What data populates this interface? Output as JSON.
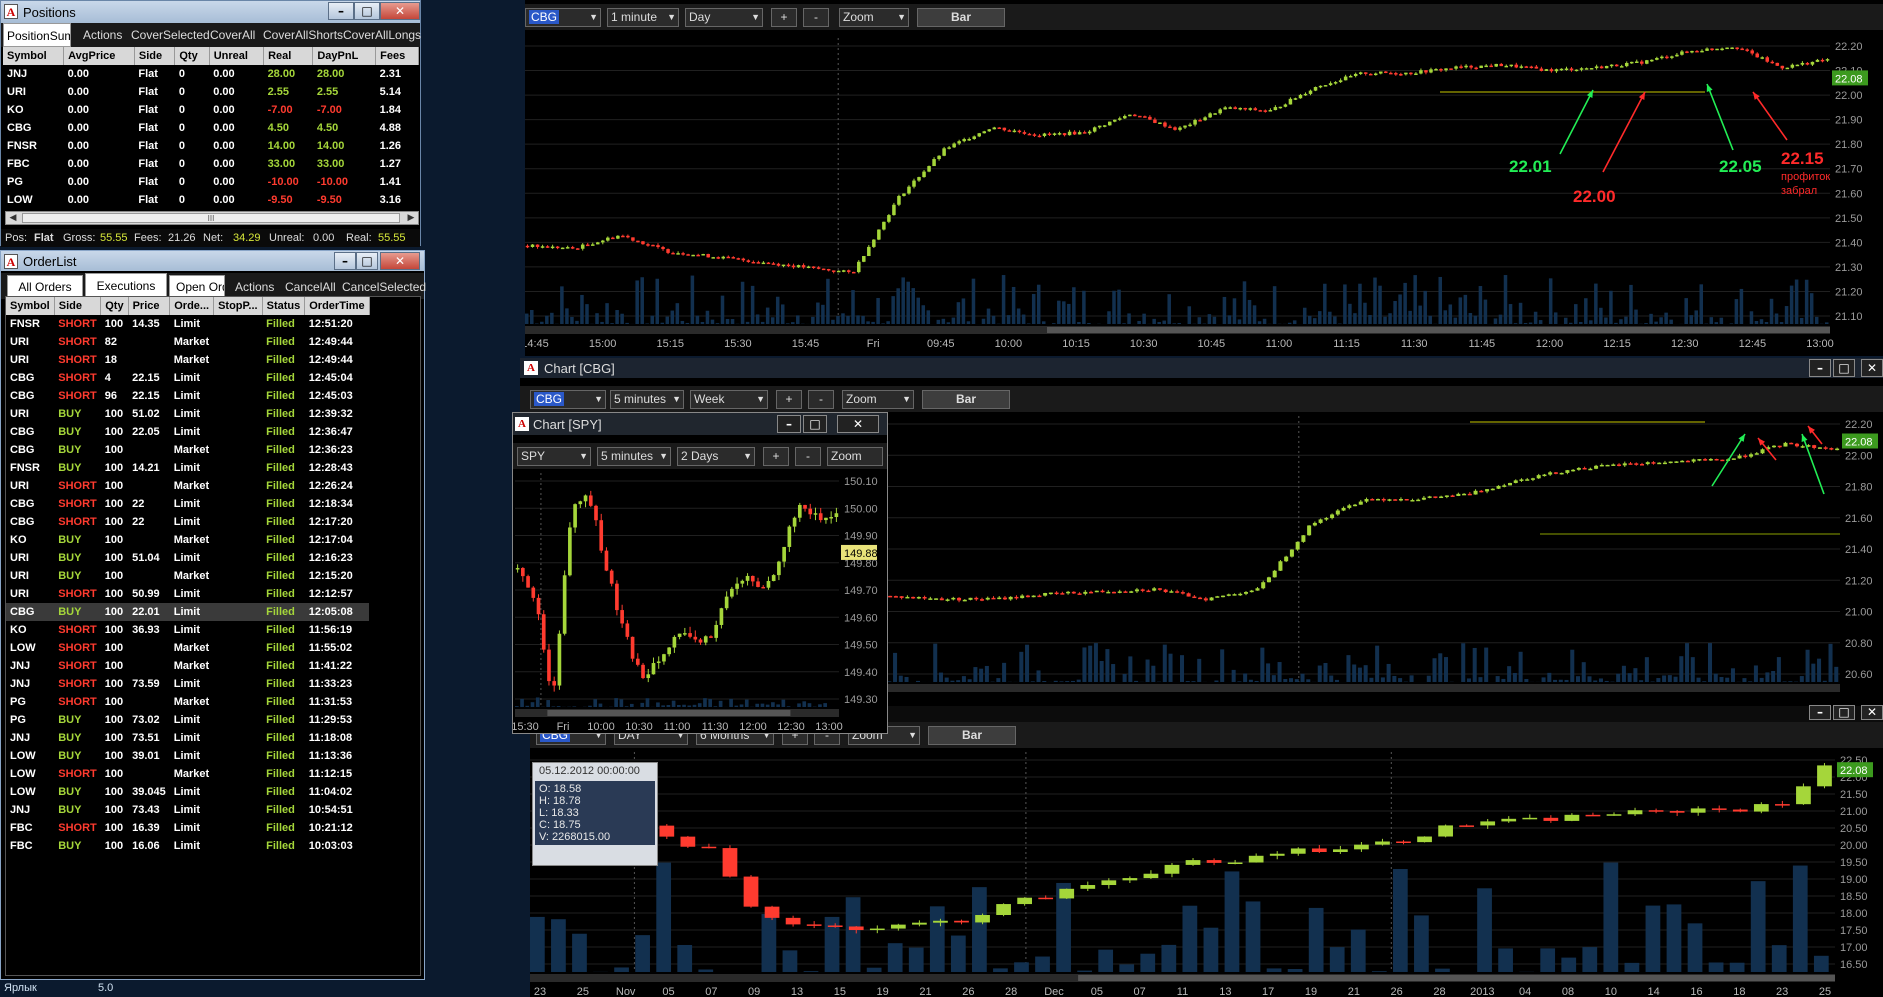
{
  "positions": {
    "title": "Positions",
    "tabs": [
      "PositionSummary",
      "Actions",
      "CoverSelected",
      "CoverAll",
      "CoverAllShorts",
      "CoverAllLongs"
    ],
    "columns": [
      "Symbol",
      "AvgPrice",
      "Side",
      "Qty",
      "Unreal",
      "Real",
      "DayPnL",
      "Fees"
    ],
    "rows": [
      [
        "JNJ",
        "0.00",
        "Flat",
        "0",
        "0.00",
        "28.00",
        "28.00",
        "2.31"
      ],
      [
        "URI",
        "0.00",
        "Flat",
        "0",
        "0.00",
        "2.55",
        "2.55",
        "5.14"
      ],
      [
        "KO",
        "0.00",
        "Flat",
        "0",
        "0.00",
        "-7.00",
        "-7.00",
        "1.84"
      ],
      [
        "CBG",
        "0.00",
        "Flat",
        "0",
        "0.00",
        "4.50",
        "4.50",
        "4.88"
      ],
      [
        "FNSR",
        "0.00",
        "Flat",
        "0",
        "0.00",
        "14.00",
        "14.00",
        "1.26"
      ],
      [
        "FBC",
        "0.00",
        "Flat",
        "0",
        "0.00",
        "33.00",
        "33.00",
        "1.27"
      ],
      [
        "PG",
        "0.00",
        "Flat",
        "0",
        "0.00",
        "-10.00",
        "-10.00",
        "1.41"
      ],
      [
        "LOW",
        "0.00",
        "Flat",
        "0",
        "0.00",
        "-9.50",
        "-9.50",
        "3.16"
      ]
    ],
    "status": {
      "pos_label": "Pos:",
      "pos": "Flat",
      "gross_label": "Gross:",
      "gross": "55.55",
      "fees_label": "Fees:",
      "fees": "21.26",
      "net_label": "Net:",
      "net": "34.29",
      "unreal_label": "Unreal:",
      "unreal": "0.00",
      "real_label": "Real:",
      "real": "55.55"
    },
    "scroll_grip": "III"
  },
  "orderlist": {
    "title": "OrderList",
    "tabs": [
      "All Orders",
      "Executions",
      "Open Orders",
      "Actions",
      "CancelAll",
      "CancelSelected"
    ],
    "columns": [
      "Symbol",
      "Side",
      "Qty",
      "Price",
      "Orde...",
      "StopP...",
      "Status",
      "OrderTime"
    ],
    "rows": [
      [
        "FNSR",
        "SHORT",
        "100",
        "14.35",
        "Limit",
        "",
        "Filled",
        "12:51:20"
      ],
      [
        "URI",
        "SHORT",
        "82",
        "",
        "Market",
        "",
        "Filled",
        "12:49:44"
      ],
      [
        "URI",
        "SHORT",
        "18",
        "",
        "Market",
        "",
        "Filled",
        "12:49:44"
      ],
      [
        "CBG",
        "SHORT",
        "4",
        "22.15",
        "Limit",
        "",
        "Filled",
        "12:45:04"
      ],
      [
        "CBG",
        "SHORT",
        "96",
        "22.15",
        "Limit",
        "",
        "Filled",
        "12:45:03"
      ],
      [
        "URI",
        "BUY",
        "100",
        "51.02",
        "Limit",
        "",
        "Filled",
        "12:39:32"
      ],
      [
        "CBG",
        "BUY",
        "100",
        "22.05",
        "Limit",
        "",
        "Filled",
        "12:36:47"
      ],
      [
        "CBG",
        "BUY",
        "100",
        "",
        "Market",
        "",
        "Filled",
        "12:36:23"
      ],
      [
        "FNSR",
        "BUY",
        "100",
        "14.21",
        "Limit",
        "",
        "Filled",
        "12:28:43"
      ],
      [
        "URI",
        "SHORT",
        "100",
        "",
        "Market",
        "",
        "Filled",
        "12:26:24"
      ],
      [
        "CBG",
        "SHORT",
        "100",
        "22",
        "Limit",
        "",
        "Filled",
        "12:18:34"
      ],
      [
        "CBG",
        "SHORT",
        "100",
        "22",
        "Limit",
        "",
        "Filled",
        "12:17:20"
      ],
      [
        "KO",
        "BUY",
        "100",
        "",
        "Market",
        "",
        "Filled",
        "12:17:04"
      ],
      [
        "URI",
        "BUY",
        "100",
        "51.04",
        "Limit",
        "",
        "Filled",
        "12:16:23"
      ],
      [
        "URI",
        "BUY",
        "100",
        "",
        "Market",
        "",
        "Filled",
        "12:15:20"
      ],
      [
        "URI",
        "SHORT",
        "100",
        "50.99",
        "Limit",
        "",
        "Filled",
        "12:12:57"
      ],
      [
        "CBG",
        "BUY",
        "100",
        "22.01",
        "Limit",
        "",
        "Filled",
        "12:05:08"
      ],
      [
        "KO",
        "SHORT",
        "100",
        "36.93",
        "Limit",
        "",
        "Filled",
        "11:56:19"
      ],
      [
        "LOW",
        "SHORT",
        "100",
        "",
        "Market",
        "",
        "Filled",
        "11:55:02"
      ],
      [
        "JNJ",
        "SHORT",
        "100",
        "",
        "Market",
        "",
        "Filled",
        "11:41:22"
      ],
      [
        "JNJ",
        "SHORT",
        "100",
        "73.59",
        "Limit",
        "",
        "Filled",
        "11:33:23"
      ],
      [
        "PG",
        "SHORT",
        "100",
        "",
        "Market",
        "",
        "Filled",
        "11:31:53"
      ],
      [
        "PG",
        "BUY",
        "100",
        "73.02",
        "Limit",
        "",
        "Filled",
        "11:29:53"
      ],
      [
        "JNJ",
        "BUY",
        "100",
        "73.51",
        "Limit",
        "",
        "Filled",
        "11:18:08"
      ],
      [
        "LOW",
        "BUY",
        "100",
        "39.01",
        "Limit",
        "",
        "Filled",
        "11:13:36"
      ],
      [
        "LOW",
        "SHORT",
        "100",
        "",
        "Market",
        "",
        "Filled",
        "11:12:15"
      ],
      [
        "LOW",
        "BUY",
        "100",
        "39.045",
        "Limit",
        "",
        "Filled",
        "11:04:02"
      ],
      [
        "JNJ",
        "BUY",
        "100",
        "73.43",
        "Limit",
        "",
        "Filled",
        "10:54:51"
      ],
      [
        "FBC",
        "SHORT",
        "100",
        "16.39",
        "Limit",
        "",
        "Filled",
        "10:21:12"
      ],
      [
        "FBC",
        "BUY",
        "100",
        "16.06",
        "Limit",
        "",
        "Filled",
        "10:03:03"
      ]
    ],
    "selected_row": 16
  },
  "chart1": {
    "symbol": "CBG",
    "interval": "1 minute",
    "period": "Day",
    "zoom": "Zoom",
    "type": "Bar",
    "plus": "+",
    "minus": "-",
    "price_labels": [
      "22.20",
      "22.10",
      "22.00",
      "21.90",
      "21.80",
      "21.70",
      "21.60",
      "21.50",
      "21.40",
      "21.30",
      "21.20",
      "21.10"
    ],
    "last": "22.08",
    "time_labels": [
      "14:45",
      "15:00",
      "15:15",
      "15:30",
      "15:45",
      "Fri",
      "09:45",
      "10:00",
      "10:15",
      "10:30",
      "10:45",
      "11:00",
      "11:15",
      "11:30",
      "11:45",
      "12:00",
      "12:15",
      "12:30",
      "12:45",
      "13:00"
    ],
    "annotations": [
      {
        "text": "22.01",
        "color": "#22ee55"
      },
      {
        "text": "22.00",
        "color": "#ff2a2a"
      },
      {
        "text": "22.05",
        "color": "#22ee55"
      },
      {
        "text": "22.15",
        "color": "#ff2a2a"
      },
      {
        "text": "профиток",
        "color": "#ff2a2a"
      },
      {
        "text": "забрал",
        "color": "#ff2a2a"
      }
    ]
  },
  "chart2": {
    "title": "Chart [CBG]",
    "symbol": "CBG",
    "interval": "5 minutes",
    "period": "Week",
    "zoom": "Zoom",
    "type": "Bar",
    "plus": "+",
    "minus": "-",
    "price_labels": [
      "22.20",
      "22.00",
      "21.80",
      "21.60",
      "21.40",
      "21.20",
      "21.00",
      "20.80",
      "20.60"
    ],
    "last": "22.08"
  },
  "chart_spy": {
    "title": "Chart [SPY]",
    "symbol": "SPY",
    "interval": "5 minutes",
    "period": "2 Days",
    "zoom": "Zoom",
    "plus": "+",
    "minus": "-",
    "price_labels": [
      "150.10",
      "150.00",
      "149.90",
      "149.80",
      "149.70",
      "149.60",
      "149.50",
      "149.40",
      "149.30"
    ],
    "last": "149.88",
    "time_labels": [
      "15:30",
      "Fri",
      "10:00",
      "10:30",
      "11:00",
      "11:30",
      "12:00",
      "12:30",
      "13:00"
    ]
  },
  "chart3": {
    "symbol": "CBG",
    "interval": "DAY",
    "period": "6 Months",
    "zoom": "Zoom",
    "type": "Bar",
    "plus": "+",
    "minus": "-",
    "price_labels": [
      "22.50",
      "22.00",
      "21.50",
      "21.00",
      "20.50",
      "20.00",
      "19.50",
      "19.00",
      "18.50",
      "18.00",
      "17.50",
      "17.00",
      "16.50"
    ],
    "last": "22.08",
    "time_labels": [
      "23",
      "25",
      "Nov",
      "05",
      "07",
      "09",
      "13",
      "15",
      "19",
      "21",
      "26",
      "28",
      "Dec",
      "05",
      "07",
      "11",
      "13",
      "17",
      "19",
      "21",
      "26",
      "28",
      "2013",
      "04",
      "08",
      "10",
      "14",
      "16",
      "18",
      "23",
      "25"
    ],
    "tooltip": {
      "date": "05.12.2012 00:00:00",
      "o": "O: 18.58",
      "h": "H: 18.78",
      "l": "L: 18.33",
      "c": "C: 18.75",
      "v": "V: 2268015.00"
    }
  },
  "desktop": {
    "label1": "Ярлык",
    "label2": "5.0"
  },
  "colors": {
    "up": "#a5d63a",
    "down": "#ff3b2f",
    "panel": "#000000",
    "grid": "#2a2a2a",
    "accent": "#2a58c8"
  }
}
